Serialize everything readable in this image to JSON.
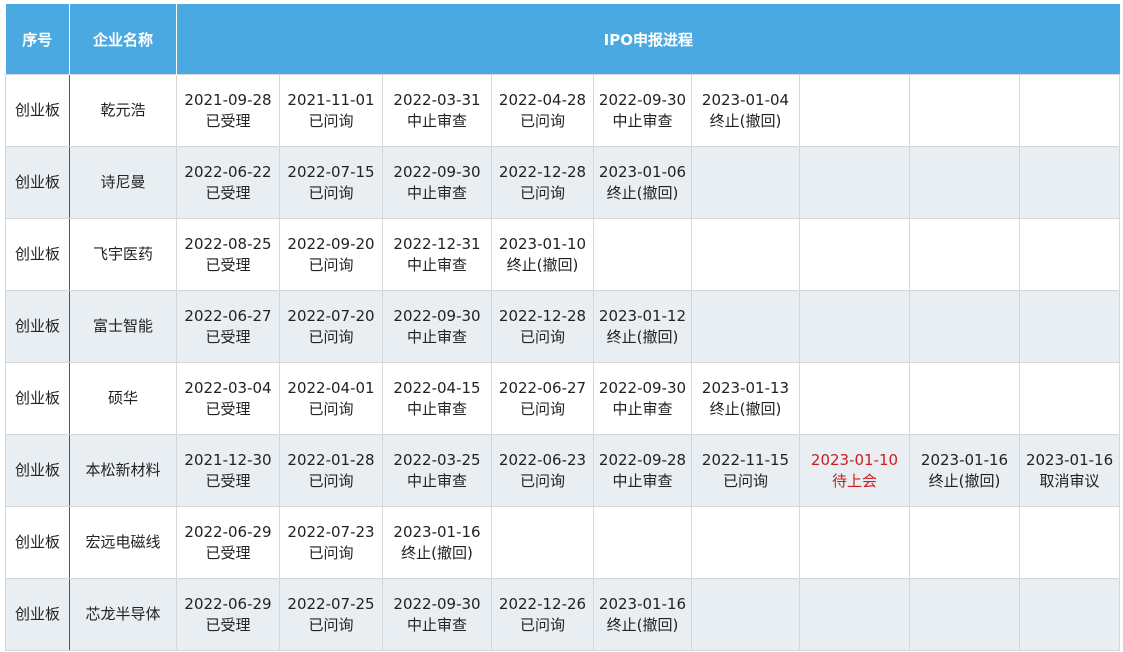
{
  "header": {
    "seq": "序号",
    "company": "企业名称",
    "progress": "IPO申报进程"
  },
  "colors": {
    "header_bg": "#4aa9e0",
    "alt_row_bg": "#e8eef2",
    "highlight_text": "#c81e1e"
  },
  "rows": [
    {
      "board": "创业板",
      "company": "乾元浩",
      "events": [
        {
          "date": "2021-09-28",
          "status": "已受理"
        },
        {
          "date": "2021-11-01",
          "status": "已问询"
        },
        {
          "date": "2022-03-31",
          "status": "中止审查"
        },
        {
          "date": "2022-04-28",
          "status": "已问询"
        },
        {
          "date": "2022-09-30",
          "status": "中止审查"
        },
        {
          "date": "2023-01-04",
          "status": "终止(撤回)"
        }
      ]
    },
    {
      "board": "创业板",
      "company": "诗尼曼",
      "events": [
        {
          "date": "2022-06-22",
          "status": "已受理"
        },
        {
          "date": "2022-07-15",
          "status": "已问询"
        },
        {
          "date": "2022-09-30",
          "status": "中止审查"
        },
        {
          "date": "2022-12-28",
          "status": "已问询"
        },
        {
          "date": "2023-01-06",
          "status": "终止(撤回)"
        }
      ]
    },
    {
      "board": "创业板",
      "company": "飞宇医药",
      "events": [
        {
          "date": "2022-08-25",
          "status": "已受理"
        },
        {
          "date": "2022-09-20",
          "status": "已问询"
        },
        {
          "date": "2022-12-31",
          "status": "中止审查"
        },
        {
          "date": "2023-01-10",
          "status": "终止(撤回)"
        }
      ]
    },
    {
      "board": "创业板",
      "company": "富士智能",
      "events": [
        {
          "date": "2022-06-27",
          "status": "已受理"
        },
        {
          "date": "2022-07-20",
          "status": "已问询"
        },
        {
          "date": "2022-09-30",
          "status": "中止审查"
        },
        {
          "date": "2022-12-28",
          "status": "已问询"
        },
        {
          "date": "2023-01-12",
          "status": "终止(撤回)"
        }
      ]
    },
    {
      "board": "创业板",
      "company": "硕华",
      "events": [
        {
          "date": "2022-03-04",
          "status": "已受理"
        },
        {
          "date": "2022-04-01",
          "status": "已问询"
        },
        {
          "date": "2022-04-15",
          "status": "中止审查"
        },
        {
          "date": "2022-06-27",
          "status": "已问询"
        },
        {
          "date": "2022-09-30",
          "status": "中止审查"
        },
        {
          "date": "2023-01-13",
          "status": "终止(撤回)"
        }
      ]
    },
    {
      "board": "创业板",
      "company": "本松新材料",
      "events": [
        {
          "date": "2021-12-30",
          "status": "已受理"
        },
        {
          "date": "2022-01-28",
          "status": "已问询"
        },
        {
          "date": "2022-03-25",
          "status": "中止审查"
        },
        {
          "date": "2022-06-23",
          "status": "已问询"
        },
        {
          "date": "2022-09-28",
          "status": "中止审查"
        },
        {
          "date": "2022-11-15",
          "status": "已问询"
        },
        {
          "date": "2023-01-10",
          "status": "待上会",
          "highlight": true
        },
        {
          "date": "2023-01-16",
          "status": "终止(撤回)"
        },
        {
          "date": "2023-01-16",
          "status": "取消审议"
        }
      ]
    },
    {
      "board": "创业板",
      "company": "宏远电磁线",
      "events": [
        {
          "date": "2022-06-29",
          "status": "已受理"
        },
        {
          "date": "2022-07-23",
          "status": "已问询"
        },
        {
          "date": "2023-01-16",
          "status": "终止(撤回)"
        }
      ]
    },
    {
      "board": "创业板",
      "company": "芯龙半导体",
      "events": [
        {
          "date": "2022-06-29",
          "status": "已受理"
        },
        {
          "date": "2022-07-25",
          "status": "已问询"
        },
        {
          "date": "2022-09-30",
          "status": "中止审查"
        },
        {
          "date": "2022-12-26",
          "status": "已问询"
        },
        {
          "date": "2023-01-16",
          "status": "终止(撤回)"
        }
      ]
    }
  ]
}
